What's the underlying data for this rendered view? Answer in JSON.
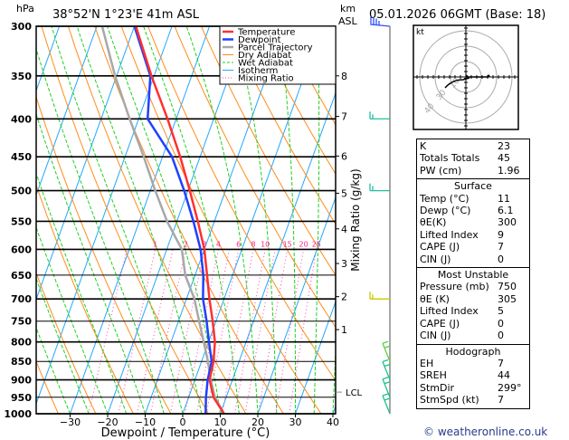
{
  "header": {
    "pressure_unit": "hPa",
    "location": "38°52'N  1°23'E  41m  ASL",
    "km_label": "km",
    "asl_label": "ASL",
    "datetime": "05.01.2026  06GMT  (Base: 18)"
  },
  "chart_data": {
    "type": "line",
    "subtype": "skew-T log-p",
    "xlabel": "Dewpoint / Temperature (°C)",
    "ylabel": "hPa",
    "xlim": [
      -40,
      40
    ],
    "ylim": [
      1000,
      300
    ],
    "y_scale": "log",
    "x_ticks": [
      "-30",
      "-20",
      "-10",
      "0",
      "10",
      "20",
      "30",
      "40"
    ],
    "y_ticks": [
      "300",
      "350",
      "400",
      "450",
      "500",
      "550",
      "600",
      "650",
      "700",
      "750",
      "800",
      "850",
      "900",
      "950",
      "1000"
    ],
    "pressure": [
      1000,
      950,
      900,
      850,
      800,
      750,
      700,
      650,
      600,
      550,
      500,
      450,
      400,
      350,
      300
    ],
    "series": [
      {
        "name": "Temperature",
        "color": "#ff3030",
        "values": [
          11,
          6.6,
          3.9,
          3.2,
          1.7,
          -0.9,
          -3.9,
          -6.8,
          -10,
          -14.4,
          -19.5,
          -25.3,
          -32.3,
          -40.7,
          -49.6
        ]
      },
      {
        "name": "Dewpoint",
        "color": "#2040ff",
        "values": [
          6.1,
          4.6,
          3.4,
          2.7,
          0.1,
          -2.5,
          -5.6,
          -7.8,
          -11,
          -15.6,
          -21,
          -27.5,
          -37.6,
          -41,
          -50
        ]
      },
      {
        "name": "Parcel Trajectory",
        "color": "#a8a8a8",
        "values": [
          11,
          7,
          4.2,
          1.7,
          -1.3,
          -4.5,
          -7.9,
          -12.6,
          -16,
          -22.6,
          -28.7,
          -35,
          -42.4,
          -50.4,
          -58.6
        ]
      }
    ],
    "legend": {
      "placement": "top-right",
      "items": [
        {
          "label": "Temperature",
          "color": "#ff3030",
          "style": "solid"
        },
        {
          "label": "Dewpoint",
          "color": "#2040ff",
          "style": "solid"
        },
        {
          "label": "Parcel Trajectory",
          "color": "#a8a8a8",
          "style": "solid"
        },
        {
          "label": "Dry Adiabat",
          "color": "#ff8c1a",
          "style": "solid"
        },
        {
          "label": "Wet Adiabat",
          "color": "#20d020",
          "style": "dashed"
        },
        {
          "label": "Isotherm",
          "color": "#20a8ff",
          "style": "solid"
        },
        {
          "label": "Mixing Ratio",
          "color": "#ff40b0",
          "style": "dotted"
        }
      ]
    },
    "mixing_ratio_label": "Mixing Ratio (g/kg)",
    "mixing_ratio_values": [
      "1",
      "2",
      "3",
      "4",
      "6",
      "8",
      "10",
      "15",
      "20",
      "25"
    ],
    "km_axis": [
      {
        "label": "8",
        "pressure": 350
      },
      {
        "label": "7",
        "pressure": 397
      },
      {
        "label": "6",
        "pressure": 449
      },
      {
        "label": "5",
        "pressure": 504
      },
      {
        "label": "4",
        "pressure": 563
      },
      {
        "label": "3",
        "pressure": 627
      },
      {
        "label": "2",
        "pressure": 695
      },
      {
        "label": "1",
        "pressure": 770
      }
    ],
    "lcl": {
      "label": "LCL",
      "pressure": 935
    },
    "wind_barbs": [
      {
        "pressure": 300,
        "color": "#3050ff"
      },
      {
        "pressure": 400,
        "color": "#20c0a0"
      },
      {
        "pressure": 500,
        "color": "#20c0a0"
      },
      {
        "pressure": 700,
        "color": "#c8c800"
      },
      {
        "pressure": 850,
        "color": "#60d040"
      },
      {
        "pressure": 900,
        "color": "#20c090"
      },
      {
        "pressure": 950,
        "color": "#20c090"
      },
      {
        "pressure": 1000,
        "color": "#20c090"
      }
    ]
  },
  "hodograph": {
    "unit": "kt",
    "ring_labels": [
      "10",
      "30",
      "40"
    ]
  },
  "indices": {
    "general": [
      {
        "label": "K",
        "value": "23"
      },
      {
        "label": "Totals Totals",
        "value": "45"
      },
      {
        "label": "PW (cm)",
        "value": "1.96"
      }
    ],
    "surface": {
      "title": "Surface",
      "rows": [
        {
          "label": "Temp (°C)",
          "value": "11"
        },
        {
          "label": "Dewp (°C)",
          "value": "6.1"
        },
        {
          "label": "θE(K)",
          "value": "300"
        },
        {
          "label": "Lifted Index",
          "value": "9"
        },
        {
          "label": "CAPE (J)",
          "value": "7"
        },
        {
          "label": "CIN (J)",
          "value": "0"
        }
      ]
    },
    "most_unstable": {
      "title": "Most Unstable",
      "rows": [
        {
          "label": "Pressure (mb)",
          "value": "750"
        },
        {
          "label": "θE (K)",
          "value": "305"
        },
        {
          "label": "Lifted Index",
          "value": "5"
        },
        {
          "label": "CAPE (J)",
          "value": "0"
        },
        {
          "label": "CIN (J)",
          "value": "0"
        }
      ]
    },
    "hodograph": {
      "title": "Hodograph",
      "rows": [
        {
          "label": "EH",
          "value": "7"
        },
        {
          "label": "SREH",
          "value": "44"
        },
        {
          "label": "StmDir",
          "value": "299°"
        },
        {
          "label": "StmSpd (kt)",
          "value": "7"
        }
      ]
    }
  },
  "footer": "© weatheronline.co.uk"
}
